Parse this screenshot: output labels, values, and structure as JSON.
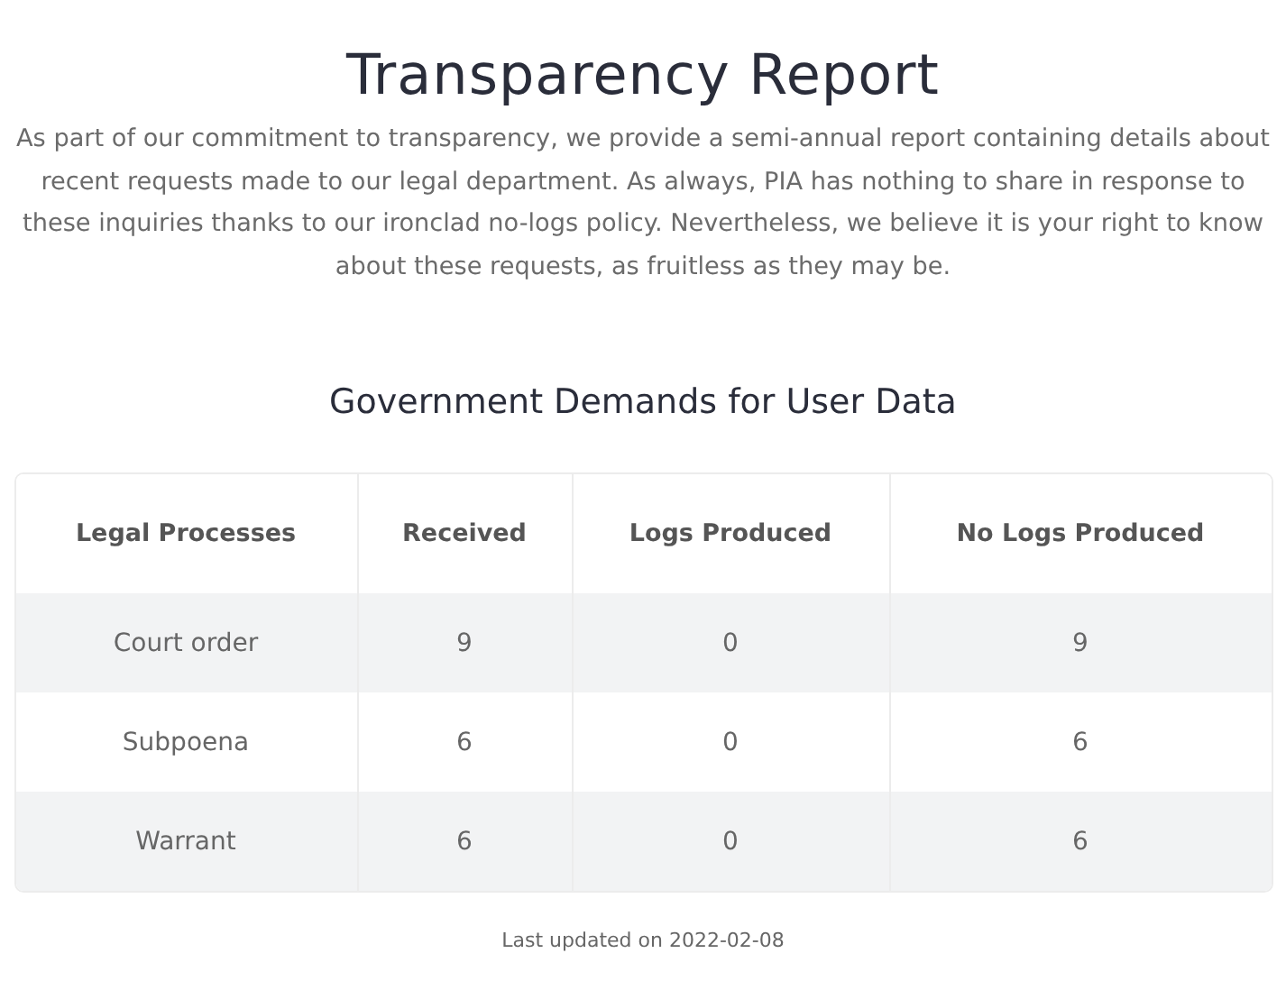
{
  "title": "Transparency Report",
  "intro": "As part of our commitment to transparency, we provide a semi-annual report containing details about recent requests made to our legal department. As always, PIA has nothing to share in response to these inquiries thanks to our ironclad no-logs policy. Nevertheless, we believe it is your right to know about these requests, as fruitless as they may be.",
  "section_title": "Government Demands for User Data",
  "table": {
    "columns": [
      "Legal Processes",
      "Received",
      "Logs Produced",
      "No Logs Produced"
    ],
    "rows": [
      [
        "Court order",
        "9",
        "0",
        "9"
      ],
      [
        "Subpoena",
        "6",
        "0",
        "6"
      ],
      [
        "Warrant",
        "6",
        "0",
        "6"
      ]
    ]
  },
  "footer": "Last updated on 2022-02-08"
}
